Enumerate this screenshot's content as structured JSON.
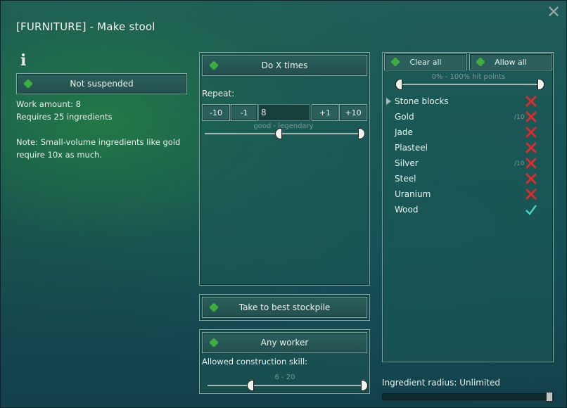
{
  "window": {
    "title": "[FURNITURE] - Make stool",
    "close_symbol": "✕"
  },
  "left": {
    "info_icon": "i",
    "suspend_button": "Not suspended",
    "work_amount": "Work amount: 8",
    "requires": "Requires 25 ingredients",
    "note_line1": "Note: Small-volume ingredients like gold",
    "note_line2": "require 10x as much."
  },
  "middle": {
    "repeat_mode_button": "Do X times",
    "repeat_label": "Repeat:",
    "minus10": "-10",
    "minus1": "-1",
    "count_value": "8",
    "plus1": "+1",
    "plus10": "+10",
    "quality_range": "good - legendary",
    "store_button": "Take to best stockpile",
    "worker_button": "Any worker",
    "skill_label": "Allowed construction skill:",
    "skill_range": "6 - 20"
  },
  "right": {
    "clear_all": "Clear all",
    "allow_all": "Allow all",
    "hitpoints_range": "0% - 100% hit points",
    "items": [
      {
        "name": "Stone blocks",
        "allowed": false,
        "tenx": ""
      },
      {
        "name": "Gold",
        "allowed": false,
        "tenx": "/10"
      },
      {
        "name": "Jade",
        "allowed": false,
        "tenx": ""
      },
      {
        "name": "Plasteel",
        "allowed": false,
        "tenx": ""
      },
      {
        "name": "Silver",
        "allowed": false,
        "tenx": "/10"
      },
      {
        "name": "Steel",
        "allowed": false,
        "tenx": ""
      },
      {
        "name": "Uranium",
        "allowed": false,
        "tenx": ""
      },
      {
        "name": "Wood",
        "allowed": true,
        "tenx": ""
      }
    ],
    "radius_label": "Ingredient radius: Unlimited"
  },
  "colors": {
    "deny": "#e02a2a",
    "allow": "#4fd0c4",
    "clover": "#3fae3f"
  },
  "icons": {
    "clover": "clover-icon",
    "deny": "red-x-icon",
    "allow": "checkmark-icon",
    "expand": "triangle-right-icon",
    "info": "info-icon",
    "close": "close-icon"
  }
}
